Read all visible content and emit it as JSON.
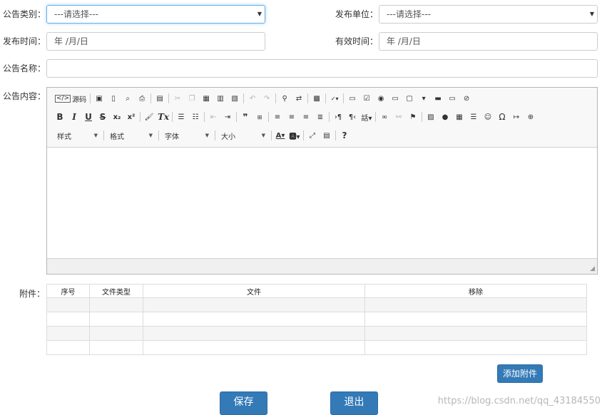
{
  "form": {
    "category_label": "公告类别：",
    "category_value": "---请选择---",
    "unit_label": "发布单位：",
    "unit_value": "---请选择---",
    "publish_time_label": "发布时间：",
    "publish_time_value": "年 /月/日",
    "valid_time_label": "有效时间：",
    "valid_time_value": "年 /月/日",
    "name_label": "公告名称：",
    "name_value": "",
    "content_label": "公告内容：",
    "attachment_label": "附件："
  },
  "editor": {
    "source_label": "源码",
    "style_combo": "样式",
    "format_combo": "格式",
    "font_combo": "字体",
    "size_combo": "大小"
  },
  "attachments": {
    "columns": [
      "序号",
      "文件类型",
      "文件",
      "移除"
    ],
    "rows": [
      [
        "",
        "",
        "",
        ""
      ],
      [
        "",
        "",
        "",
        ""
      ],
      [
        "",
        "",
        "",
        ""
      ],
      [
        "",
        "",
        "",
        ""
      ]
    ]
  },
  "buttons": {
    "add_attachment": "添加附件",
    "save": "保存",
    "exit": "退出"
  },
  "watermark": "https://blog.csdn.net/qq_43184550",
  "colors": {
    "primary": "#337ab7",
    "focus_border": "#66afe9"
  }
}
